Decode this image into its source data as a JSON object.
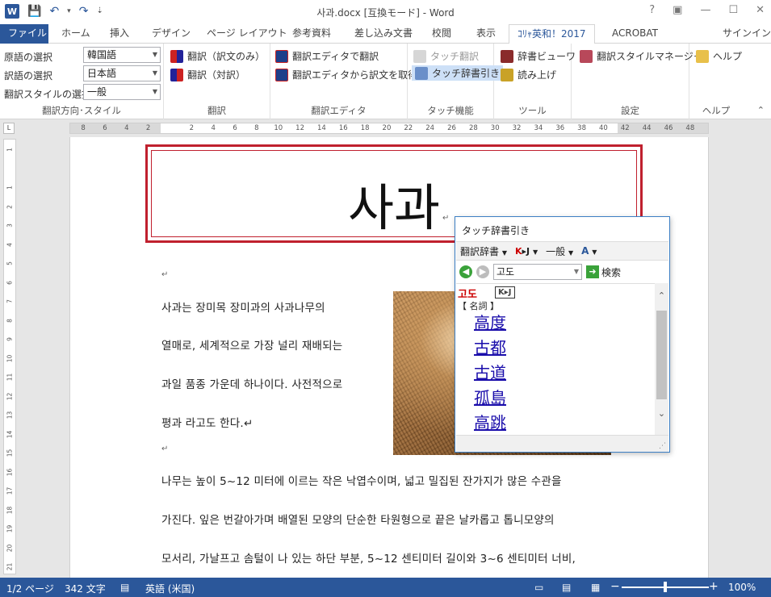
{
  "app": {
    "title": "사과.docx [互換モード] - Word",
    "logo": "W",
    "qat": {
      "save": "💾",
      "undo": "↶",
      "undo_more": "▾",
      "redo": "↷",
      "customize": "⇣"
    },
    "window_controls": [
      "?",
      "▣",
      "—",
      "☐",
      "✕"
    ]
  },
  "tabs": {
    "file": "ファイル",
    "items": [
      "ホーム",
      "挿入",
      "デザイン",
      "ページ レイアウト",
      "参考資料",
      "差し込み文書",
      "校閲",
      "表示",
      "ｺﾘｬ英和！2017",
      "ACROBAT"
    ],
    "active": "ｺﾘｬ英和！2017",
    "signin": "サインイン"
  },
  "ribbon": {
    "direction_group": {
      "label": "翻訳方向･スタイル",
      "source_label": "原語の選択",
      "source_value": "韓国語",
      "target_label": "訳語の選択",
      "target_value": "日本語",
      "style_label": "翻訳スタイルの選択",
      "style_value": "一般"
    },
    "translate_group": {
      "label": "翻訳",
      "translate_only": "翻訳（訳文のみ）",
      "translate_pair": "翻訳（対訳）"
    },
    "editor_group": {
      "label": "翻訳エディタ",
      "translate_in_editor": "翻訳エディタで翻訳",
      "fetch_from_editor": "翻訳エディタから訳文を取得"
    },
    "touch_group": {
      "label": "タッチ機能",
      "touch_translate": "タッチ翻訳",
      "touch_dictionary": "タッチ辞書引き"
    },
    "tools_group": {
      "label": "ツール",
      "dict_viewer": "辞書ビューワ",
      "read_aloud": "読み上げ"
    },
    "settings_group": {
      "label": "設定",
      "style_manager": "翻訳スタイルマネージャ"
    },
    "help_group": {
      "label": "ヘルプ",
      "help": "ヘルプ"
    },
    "collapse": "⌃"
  },
  "ruler": {
    "tab_selector": "L",
    "ticks": [
      "8",
      "6",
      "4",
      "2",
      "",
      "2",
      "4",
      "6",
      "8",
      "10",
      "12",
      "14",
      "16",
      "18",
      "20",
      "22",
      "24",
      "26",
      "28",
      "30",
      "32",
      "34",
      "36",
      "38",
      "40",
      "42",
      "44",
      "46",
      "48"
    ],
    "vticks": [
      "1",
      "",
      "1",
      "2",
      "3",
      "4",
      "5",
      "6",
      "7",
      "8",
      "9",
      "10",
      "11",
      "12",
      "13",
      "14",
      "15",
      "16",
      "17",
      "18",
      "19",
      "20",
      "21"
    ]
  },
  "document": {
    "heading": "사과",
    "paragraph_mark": "↵",
    "lines": [
      "사과는 장미목 장미과의 사과나무의",
      "열매로, 세계적으로 가장 널리 재배되는",
      "과일 품종 가운데 하나이다. 사전적으로",
      "평과 라고도 한다.↵",
      "나무는 높이 5~12 미터에 이르는 작은 낙엽수이며, 넓고 밀집된 잔가지가 많은 수관을",
      "가진다. 잎은 번갈아가며 배열된 모양의 단순한 타원형으로 끝은 날카롭고 톱니모양의",
      "모서리, 가날프고 솜털이 나 있는 하단 부분, 5~12 센티미터 길이와 3~6 센티미터 너비,"
    ]
  },
  "popup": {
    "title": "タッチ辞書引き",
    "toolbar": {
      "dict_menu": "翻訳辞書",
      "kj_k": "K",
      "kj_rest": "▸J",
      "style_menu": "一般",
      "extra_icon": "A"
    },
    "search": {
      "value": "고도",
      "button": "検索"
    },
    "headword": "고도",
    "source_badge": "K▸J",
    "pos": "【 名詞 】",
    "entries": [
      "高度",
      "古都",
      "古道",
      "孤島",
      "高跳"
    ]
  },
  "statusbar": {
    "page": "1/2 ページ",
    "words": "342 文字",
    "language": "英語 (米国)",
    "zoom_out": "−",
    "zoom_in": "+",
    "zoom": "100%",
    "zoom_level": 0.5
  }
}
